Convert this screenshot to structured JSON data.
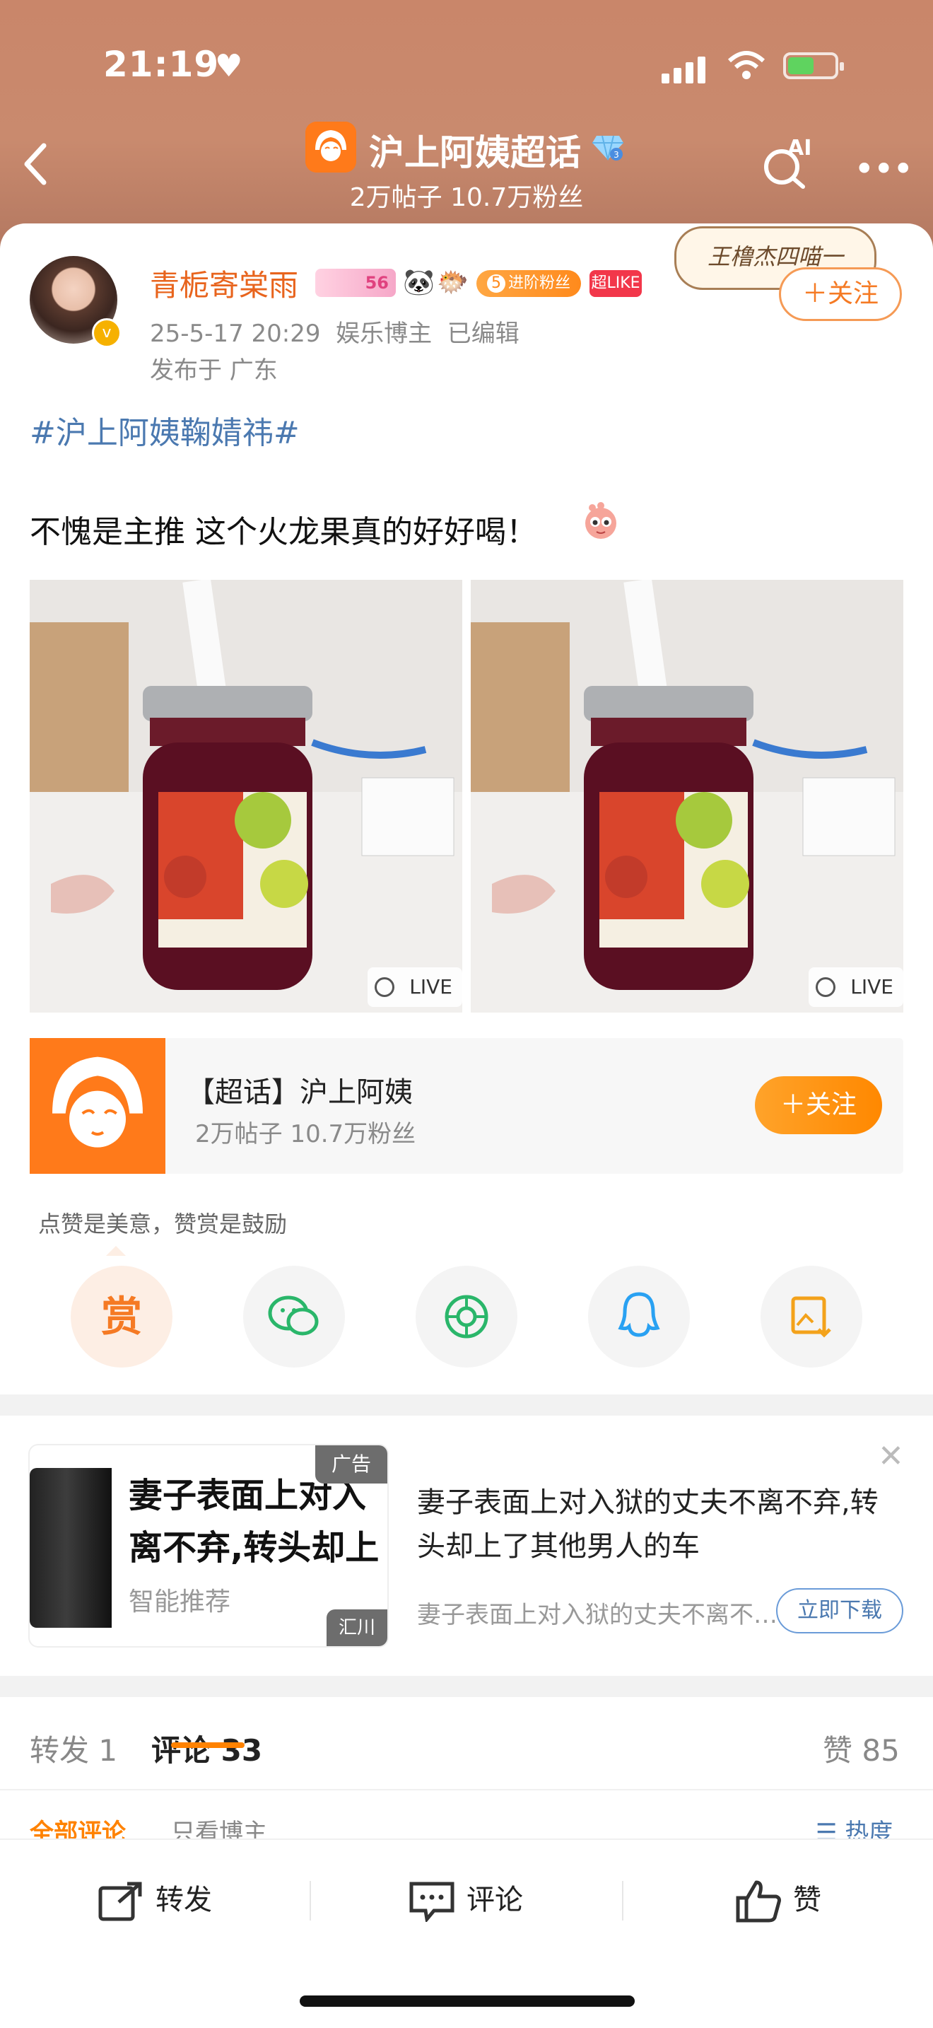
{
  "status_bar": {
    "time": "21:19",
    "heart": "♥"
  },
  "header": {
    "back_icon": "chevron-left-icon",
    "topic_name": "沪上阿姨超话",
    "topic_stats": "2万帖子 10.7万粉丝",
    "ai_label": "AI"
  },
  "post": {
    "username": "青栀寄棠雨",
    "level_badge": "56",
    "fan_badge": "进阶粉丝",
    "fan_badge_level": "5",
    "superlike_badge": "超LIKE",
    "meta": "25-5-17 20:29  娱乐博主  已编辑",
    "location": "发布于 广东",
    "decoration_text": "王橹杰四喵一",
    "follow_label": "＋关注",
    "hashtag": "#沪上阿姨鞠婧祎#",
    "text": "不愧是主推 这个火龙果真的好好喝！",
    "photos": [
      {
        "live_label": "LIVE"
      },
      {
        "live_label": "LIVE"
      }
    ]
  },
  "topic_card": {
    "title": "【超话】沪上阿姨",
    "stats": "2万帖子 10.7万粉丝",
    "follow_label": "＋关注"
  },
  "reward": {
    "tip": "点赞是美意，赞赏是鼓励",
    "reward_glyph": "赏",
    "share_icons": [
      "reward-icon",
      "wechat-icon",
      "moments-icon",
      "qq-icon",
      "save-image-icon"
    ]
  },
  "ad": {
    "tag": "广告",
    "headline_line1": "妻子表面上对入",
    "headline_line2": "离不弃,转头却上",
    "smart": "智能推荐",
    "brand": "汇川",
    "title": "妻子表面上对入狱的丈夫不离不弃,转头却上了其他男人的车",
    "desc": "妻子表面上对入狱的丈夫不离不弃,转头却上了其他男人的车",
    "download_label": "立即下载"
  },
  "tabs": {
    "repost": "转发 1",
    "comment": "评论 33",
    "like": "赞 85",
    "sub_all": "全部评论",
    "sub_author": "只看博主",
    "sort": "热度"
  },
  "bottom_bar": {
    "repost": "转发",
    "comment": "评论",
    "like": "赞"
  },
  "colors": {
    "accent": "#ff8200",
    "header_bg": "#c9866a",
    "username": "#e8641d",
    "hashtag": "#4b79b0"
  }
}
